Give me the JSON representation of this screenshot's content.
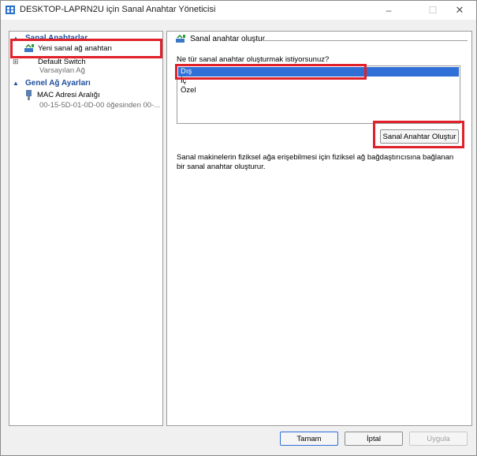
{
  "window": {
    "title": "DESKTOP-LAPRN2U için Sanal Anahtar Yöneticisi"
  },
  "left_panel": {
    "section_switches": "Sanal Anahtarlar",
    "new_switch": "Yeni sanal ağ anahtarı",
    "default_switch": {
      "name": "Default Switch",
      "sub": "Varsayılan Ağ"
    },
    "section_global": "Genel Ağ Ayarları",
    "mac_range": {
      "name": "MAC Adresi Aralığı",
      "sub": "00-15-5D-01-0D-00 öğesinden 00-..."
    }
  },
  "right_panel": {
    "title": "Sanal anahtar oluştur",
    "question": "Ne tür sanal anahtar oluşturmak istiyorsunuz?",
    "options": [
      "Dış",
      "İç",
      "Özel"
    ],
    "selected_option": "Dış",
    "create_button": "Sanal Anahtar Oluştur",
    "description": "Sanal makinelerin fiziksel ağa erişebilmesi için fiziksel ağ bağdaştırıcısına bağlanan bir sanal anahtar oluşturur."
  },
  "footer": {
    "ok": "Tamam",
    "cancel": "İptal",
    "apply": "Uygula"
  },
  "colors": {
    "section_header": "#1f4e9c",
    "selection": "#2f6fd6",
    "highlight_box": "#e0202a"
  },
  "icons": [
    "hyperv-app-icon",
    "network-switch-icon",
    "nic-icon",
    "collapse-chevron-icon"
  ]
}
